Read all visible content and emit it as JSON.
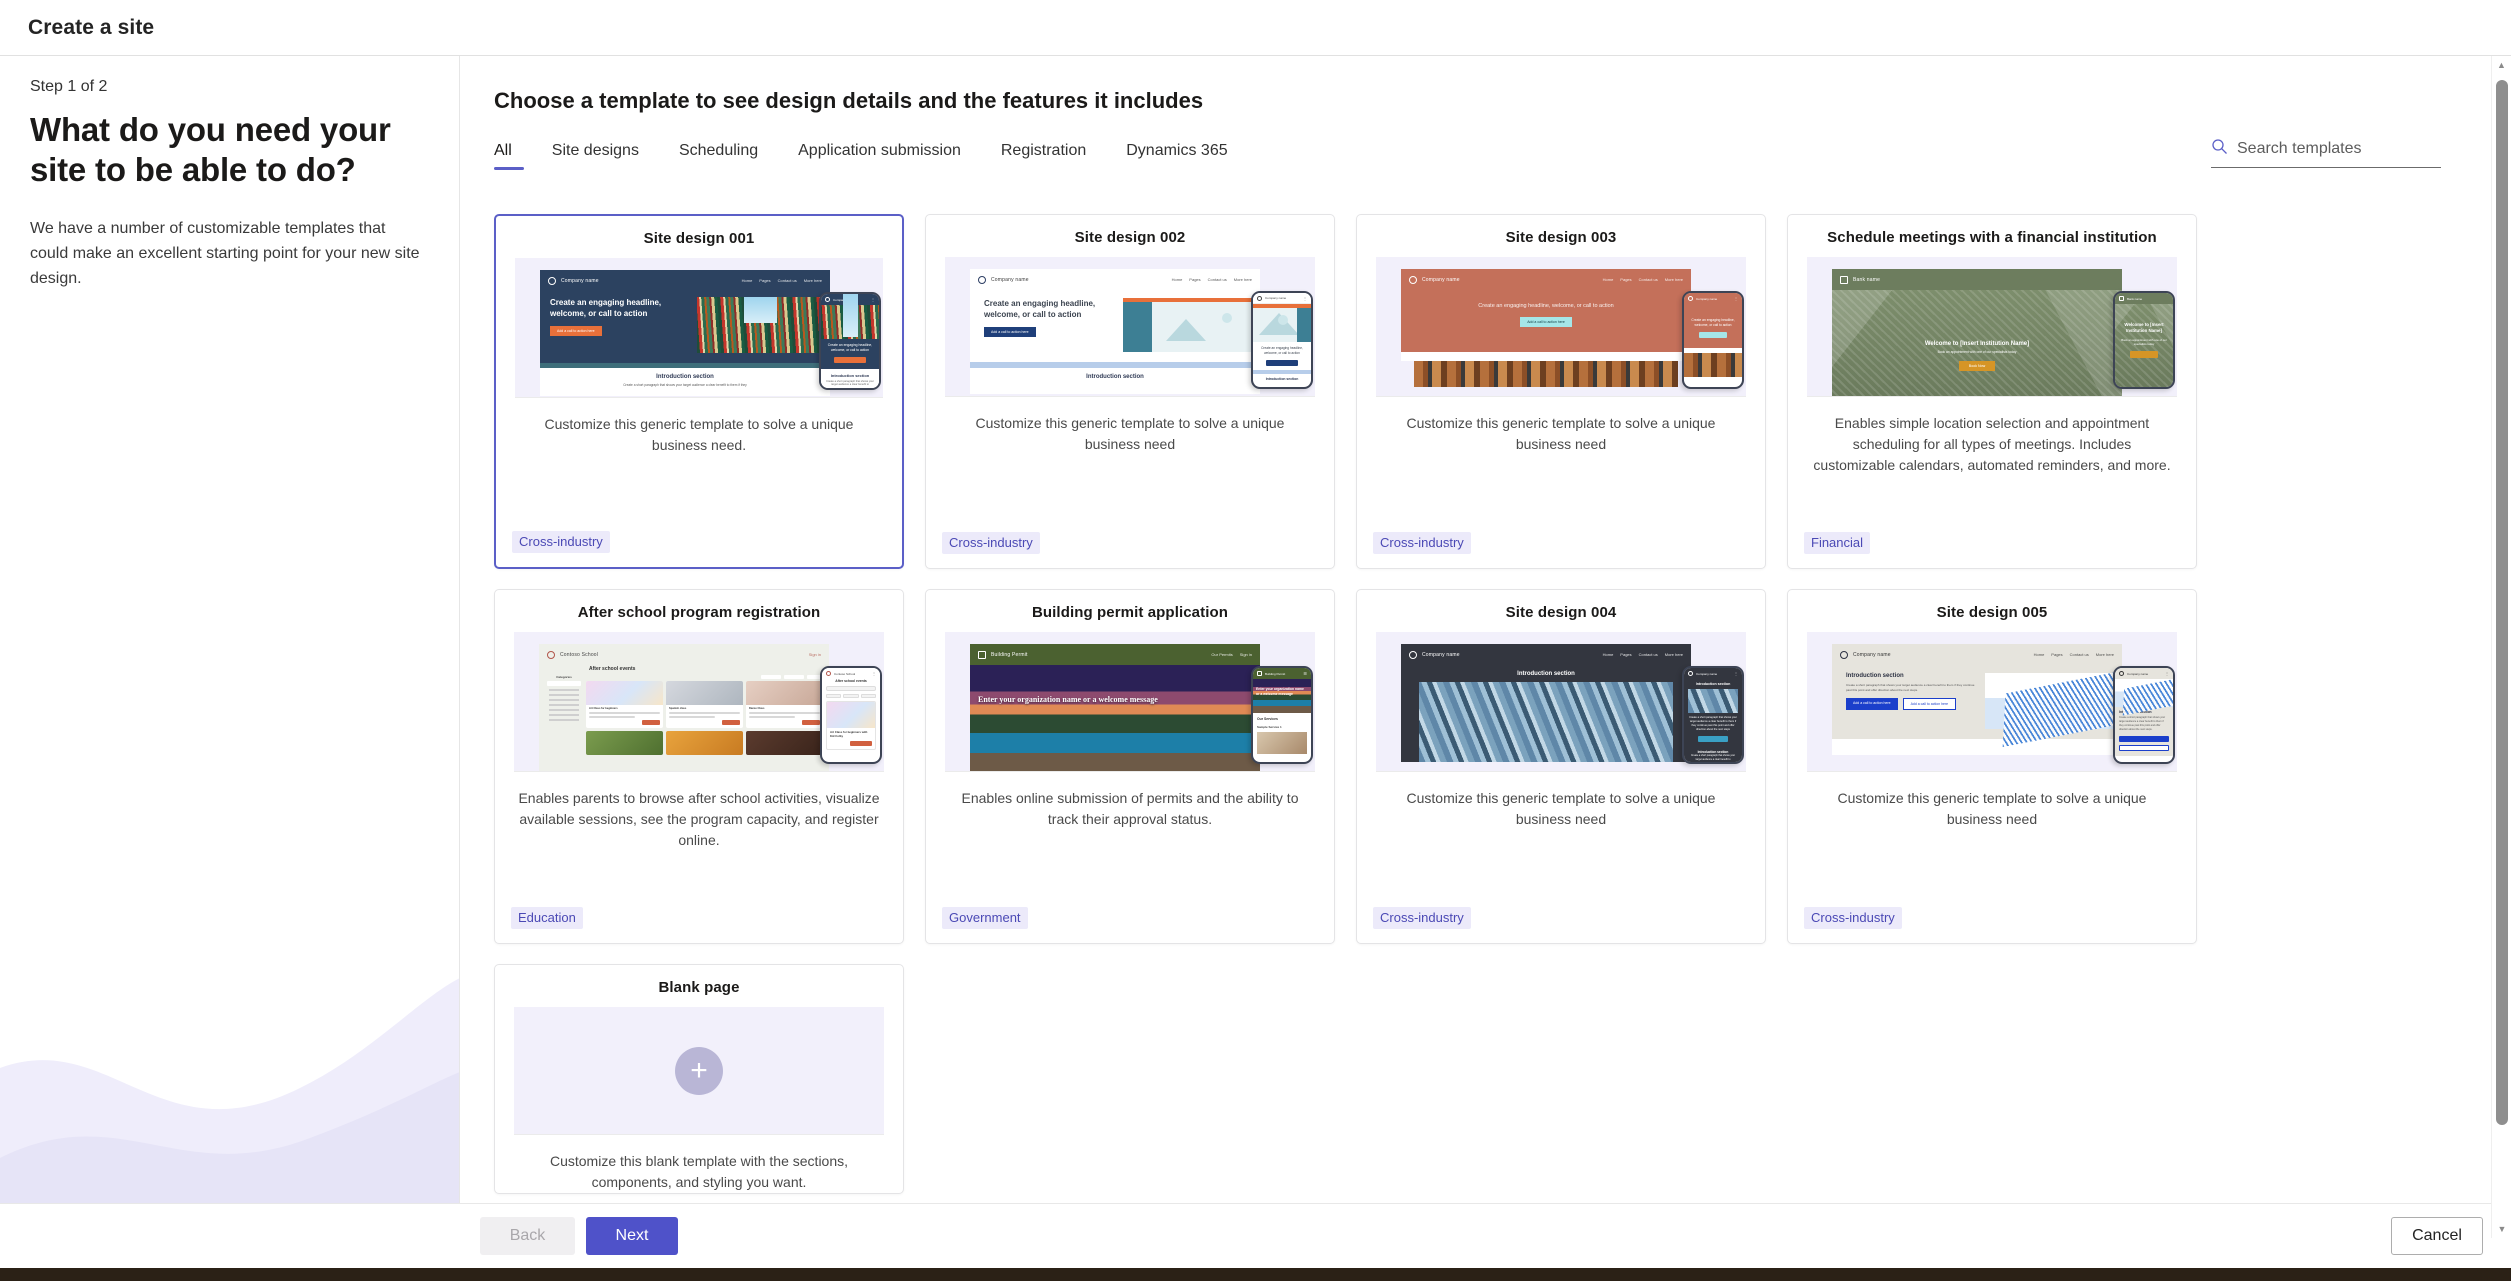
{
  "window": {
    "title": "Create a site"
  },
  "sidebar": {
    "step": "Step 1 of 2",
    "heading": "What do you need your site to be able to do?",
    "description": "We have a number of customizable templates that could make an excellent starting point for your new site design."
  },
  "main": {
    "title": "Choose a template to see design details and the features it includes",
    "tabs": [
      {
        "label": "All",
        "active": true
      },
      {
        "label": "Site designs",
        "active": false
      },
      {
        "label": "Scheduling",
        "active": false
      },
      {
        "label": "Application submission",
        "active": false
      },
      {
        "label": "Registration",
        "active": false
      },
      {
        "label": "Dynamics 365",
        "active": false
      }
    ],
    "search": {
      "placeholder": "Search templates",
      "value": "",
      "icon": "search-icon"
    }
  },
  "templates": [
    {
      "title": "Site design 001",
      "description": "Customize this generic template to solve a unique business need.",
      "tag": "Cross-industry",
      "selected": true,
      "thumb": {
        "brand": "Company name",
        "nav": [
          "Home",
          "Pages",
          "Contact us",
          "More here"
        ],
        "headline": "Create an engaging headline, welcome, or call to action",
        "cta": "Add a call to action here",
        "section_title": "Introduction section",
        "section_body": "Create a short paragraph that shows your target audience a clear benefit to them if they"
      }
    },
    {
      "title": "Site design 002",
      "description": "Customize this generic template to solve a unique business need",
      "tag": "Cross-industry",
      "selected": false,
      "thumb": {
        "brand": "Company name",
        "nav": [
          "Home",
          "Pages",
          "Contact us",
          "More here"
        ],
        "headline": "Create an engaging headline, welcome, or call to action",
        "cta": "Add a call to action here",
        "section_title": "Introduction section",
        "section_body": ""
      }
    },
    {
      "title": "Site design 003",
      "description": "Customize this generic template to solve a unique business need",
      "tag": "Cross-industry",
      "selected": false,
      "thumb": {
        "brand": "Company name",
        "nav": [
          "Home",
          "Pages",
          "Contact us",
          "More here"
        ],
        "headline": "Create an engaging headline, welcome, or call to action",
        "cta": "Add a call to action here",
        "section_title": "",
        "section_body": ""
      }
    },
    {
      "title": "Schedule meetings with a financial institution",
      "description": "Enables simple location selection and appointment scheduling for all types of meetings. Includes customizable calendars, automated reminders, and more.",
      "tag": "Financial",
      "selected": false,
      "thumb": {
        "brand": "Bank name",
        "nav": [],
        "headline": "Welcome to [Insert Institution Name]",
        "subhead": "Book an appointment with one of our specialists today",
        "cta": "Book Now",
        "section_title": "",
        "section_body": ""
      }
    },
    {
      "title": "After school program registration",
      "description": "Enables parents to browse after school activities, visualize available sessions, see the program capacity, and register online.",
      "tag": "Education",
      "selected": false,
      "thumb": {
        "brand": "Contoso School",
        "nav": [
          "Sign in"
        ],
        "headline": "After school events",
        "cta": "Register",
        "section_title": "Categories",
        "section_body": "Art Class for beginners"
      }
    },
    {
      "title": "Building permit application",
      "description": "Enables online submission of permits and the ability to track their approval status.",
      "tag": "Government",
      "selected": false,
      "thumb": {
        "brand": "Building Permit",
        "nav": [
          "Our Permits",
          "Sign in"
        ],
        "headline": "Enter your organization name or a welcome message",
        "cta": "",
        "section_title": "Our Services",
        "section_body": "Sample Service 1"
      }
    },
    {
      "title": "Site design 004",
      "description": "Customize this generic template to solve a unique business need",
      "tag": "Cross-industry",
      "selected": false,
      "thumb": {
        "brand": "Company name",
        "nav": [
          "Home",
          "Pages",
          "Contact us",
          "More here"
        ],
        "headline": "Introduction section",
        "cta": "",
        "section_title": "Introduction section",
        "section_body": ""
      }
    },
    {
      "title": "Site design 005",
      "description": "Customize this generic template to solve a unique business need",
      "tag": "Cross-industry",
      "selected": false,
      "thumb": {
        "brand": "Company name",
        "nav": [
          "Home",
          "Pages",
          "Contact us",
          "More here"
        ],
        "headline": "Introduction section",
        "subhead": "Create a short paragraph that shows your target audience a clear benefit to them if they continue past this point and offer direction about the next steps.",
        "cta": "Add a call to action here",
        "cta2": "Add a call to action here",
        "section_title": "",
        "section_body": ""
      }
    }
  ],
  "blank_template": {
    "title": "Blank page",
    "description": "Customize this blank template with the sections, components, and styling you want.",
    "icon": "plus-icon"
  },
  "footer": {
    "back_label": "Back",
    "next_label": "Next",
    "cancel_label": "Cancel"
  },
  "colors": {
    "accent": "#5b5fc7",
    "primary_button": "#4f52c9",
    "tag_bg": "#eceafa",
    "tag_text": "#4b49b5",
    "wave": "#e8e5f8"
  },
  "scrollbar": {
    "up_icon": "chevron-up-icon",
    "down_icon": "chevron-down-icon"
  }
}
